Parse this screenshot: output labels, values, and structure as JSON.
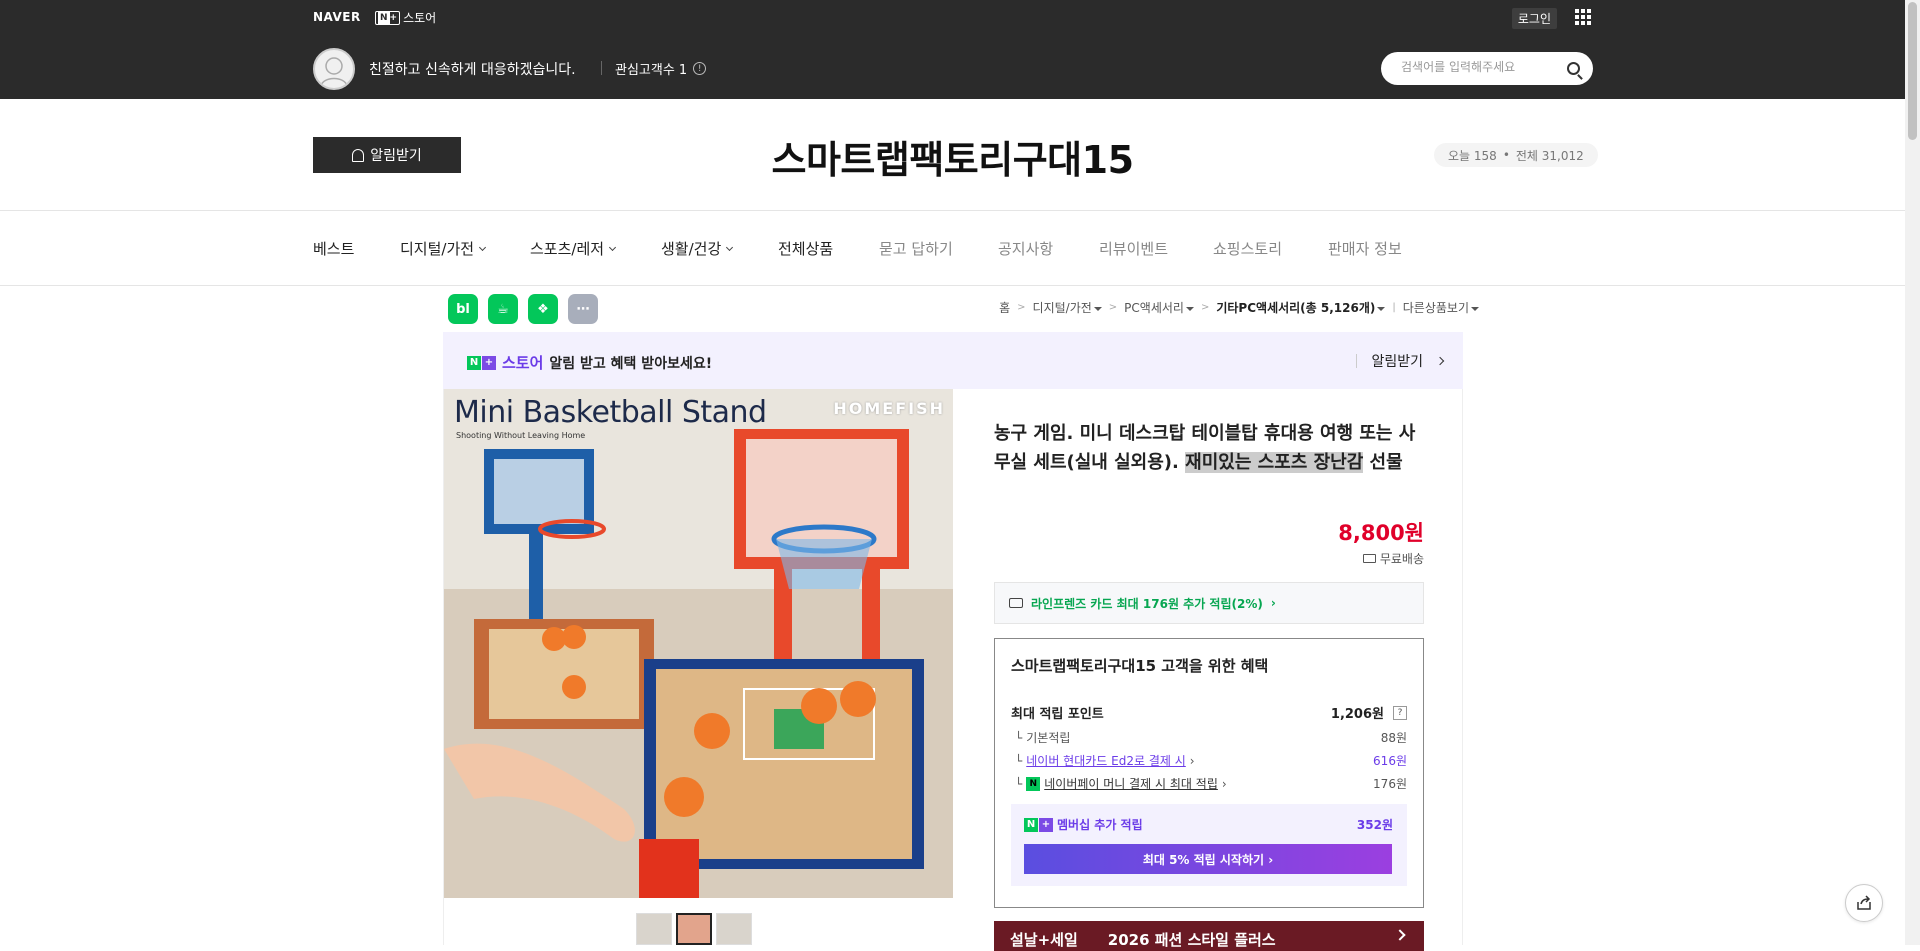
{
  "topbar": {
    "naver_logo": "NAVER",
    "store_logo_text": "스토어",
    "login": "로그인",
    "greeting": "친절하고 신속하게 대응하겠습니다.",
    "fans_label": "관심고객수 1",
    "search_placeholder": "검색어를 입력해주세요"
  },
  "header": {
    "alert_button": "알림받기",
    "store_name": "스마트랩팩토리구대15",
    "visits_today": "오늘 158",
    "visits_total": "전체 31,012"
  },
  "nav": {
    "items": [
      {
        "label": "베스트"
      },
      {
        "label": "디지털/가전"
      },
      {
        "label": "스포츠/레저"
      },
      {
        "label": "생활/건강"
      },
      {
        "label": "전체상품"
      },
      {
        "label": "묻고 답하기"
      },
      {
        "label": "공지사항"
      },
      {
        "label": "리뷰이벤트"
      },
      {
        "label": "쇼핑스토리"
      },
      {
        "label": "판매자 정보"
      }
    ]
  },
  "share_icons": [
    "bl",
    "☕",
    "❖",
    "⋯"
  ],
  "breadcrumb": {
    "home": "홈",
    "cat1": "디지털/가전",
    "cat2": "PC액세서리",
    "cat3": "기타PC액세서리(총 5,126개)",
    "other": "다른상품보기"
  },
  "promo": {
    "store_word": "스토어",
    "text": "알림 받고 혜택 받아보세요!",
    "action": "알림받기"
  },
  "product_image": {
    "title": "Mini Basketball Stand",
    "subtitle": "Shooting Without Leaving Home",
    "brand": "HOMEFISH"
  },
  "product": {
    "title_a": "농구 게임. 미니 데스크탑 테이블탑 휴대용 여행 또는 사무실 세트(실내 실외용). ",
    "title_highlight": "재미있는 스포츠 장난감",
    "title_b": " 선물",
    "price": "8,800원",
    "shipping": "무료배송",
    "card_benefit": "라인프렌즈 카드 최대 176원 추가 적립(2%)"
  },
  "benefits": {
    "title": "스마트랩팩토리구대15 고객을 위한 혜택",
    "max_label": "최대 적립 포인트",
    "max_value": "1,206원",
    "rows": [
      {
        "label": "기본적립",
        "value": "88원"
      },
      {
        "label": "네이버 현대카드 Ed2로 결제 시",
        "value": "616원"
      },
      {
        "label": "네이버페이 머니 결제 시 최대 적립",
        "value": "176원"
      }
    ],
    "member_label": "멤버십 추가 적립",
    "member_value": "352원",
    "member_button": "최대 5% 적립 시작하기"
  },
  "bottom_banner": {
    "left": "설날+세일",
    "right": "2026 패션 스타일 플러스"
  },
  "colors": {
    "topbar_bg": "#2b2b2b",
    "naver_green": "#03c75a",
    "price_red": "#e0002a",
    "purple": "#6b3ce8"
  }
}
